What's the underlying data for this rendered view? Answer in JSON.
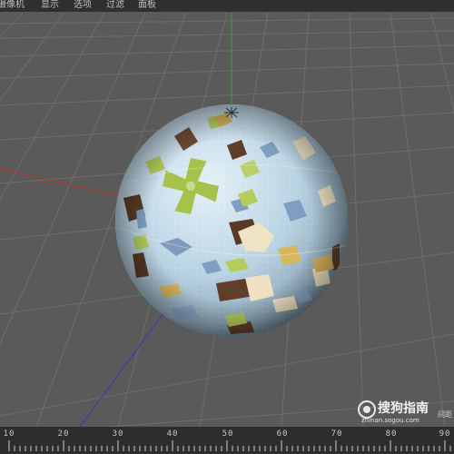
{
  "menu": {
    "items": [
      "摄像机",
      "显示",
      "选项",
      "过滤",
      "面板"
    ]
  },
  "timeline": {
    "ticks": [
      "10",
      "20",
      "30",
      "40",
      "50",
      "60",
      "70",
      "80",
      "90"
    ]
  },
  "watermark": {
    "text": "搜狗指南",
    "url": "zhinan.sogou.com",
    "extra": "间距"
  },
  "colors": {
    "viewport_bg": "#5a5a5a",
    "grid_line": "#6b6b6b",
    "axis_x": "#c0302a",
    "axis_y": "#2fa83a",
    "axis_z": "#3338b8",
    "sphere_base": "#bcd6e6"
  }
}
